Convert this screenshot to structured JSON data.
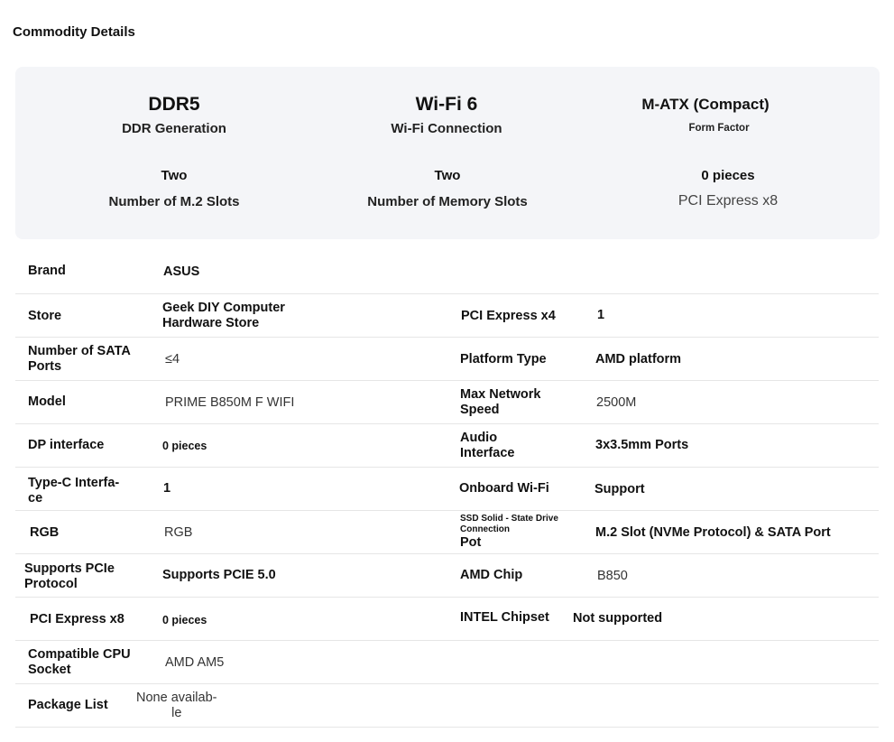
{
  "page_title": "Commodity Details",
  "highlights": [
    {
      "value": "DDR5",
      "label": "DDR Generation"
    },
    {
      "value": "Wi-Fi 6",
      "label": "Wi-Fi Connection"
    },
    {
      "value": "M-ATX (Compact)",
      "label": "Form Factor"
    },
    {
      "value": "Two",
      "label": "Number of M.2 Slots"
    },
    {
      "value": "Two",
      "label": "Number of Memory Slots"
    },
    {
      "value": "0 pieces",
      "label": "PCI Express x8"
    }
  ],
  "specs": {
    "brand": {
      "key": "Brand",
      "value": "ASUS"
    },
    "store": {
      "key": "Store",
      "value_line1": "Geek DIY Computer",
      "value_line2": "Hardware Store"
    },
    "pci_x4": {
      "key": "PCI Express x4",
      "value": "1"
    },
    "sata": {
      "key_line1": "Number of SATA",
      "key_line2": "Ports",
      "value": "≤4"
    },
    "platform": {
      "key": "Platform Type",
      "value": "AMD platform"
    },
    "model": {
      "key": "Model",
      "value": "PRIME B850M F WIFI"
    },
    "network": {
      "key_line1": "Max Network",
      "key_line2": "Speed",
      "value": "2500M"
    },
    "dp": {
      "key": "DP interface",
      "value": "0 pieces"
    },
    "audio": {
      "key_line1": "Audio",
      "key_line2": "Interface",
      "value": "3x3.5mm Ports"
    },
    "typec": {
      "key_line1": "Type-C Interfa-",
      "key_line2": "ce",
      "value": "1"
    },
    "wifi": {
      "key": "Onboard Wi-Fi",
      "value": "Support"
    },
    "rgb": {
      "key": "RGB",
      "value": "RGB"
    },
    "ssd": {
      "key_line1": "SSD Solid - State Drive",
      "key_line2": "Connection",
      "key_line3": "Pot",
      "value": "M.2 Slot (NVMe Protocol) & SATA Port"
    },
    "pcie_proto": {
      "key_line1": "Supports PCIe",
      "key_line2": "Protocol",
      "value": "Supports PCIE 5.0"
    },
    "amd_chip": {
      "key": "AMD Chip",
      "value": "B850"
    },
    "pci_x8": {
      "key": "PCI Express x8",
      "value": "0 pieces"
    },
    "intel": {
      "key": "INTEL Chipset",
      "value": "Not supported"
    },
    "cpu_socket": {
      "key_line1": "Compatible CPU",
      "key_line2": "Socket",
      "value": "AMD AM5"
    },
    "package": {
      "key": "Package List",
      "value_line1": "None availab-",
      "value_line2": "le"
    }
  }
}
